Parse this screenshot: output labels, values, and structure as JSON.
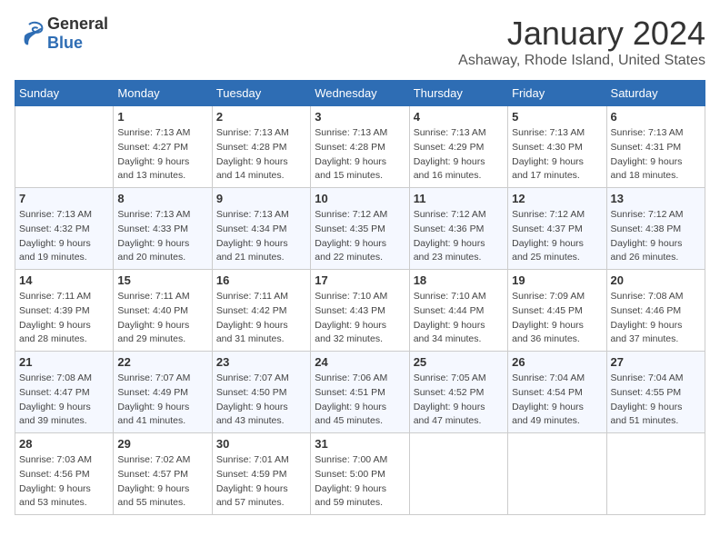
{
  "logo": {
    "general": "General",
    "blue": "Blue"
  },
  "title": "January 2024",
  "subtitle": "Ashaway, Rhode Island, United States",
  "headers": [
    "Sunday",
    "Monday",
    "Tuesday",
    "Wednesday",
    "Thursday",
    "Friday",
    "Saturday"
  ],
  "weeks": [
    [
      {
        "num": "",
        "info": ""
      },
      {
        "num": "1",
        "info": "Sunrise: 7:13 AM\nSunset: 4:27 PM\nDaylight: 9 hours\nand 13 minutes."
      },
      {
        "num": "2",
        "info": "Sunrise: 7:13 AM\nSunset: 4:28 PM\nDaylight: 9 hours\nand 14 minutes."
      },
      {
        "num": "3",
        "info": "Sunrise: 7:13 AM\nSunset: 4:28 PM\nDaylight: 9 hours\nand 15 minutes."
      },
      {
        "num": "4",
        "info": "Sunrise: 7:13 AM\nSunset: 4:29 PM\nDaylight: 9 hours\nand 16 minutes."
      },
      {
        "num": "5",
        "info": "Sunrise: 7:13 AM\nSunset: 4:30 PM\nDaylight: 9 hours\nand 17 minutes."
      },
      {
        "num": "6",
        "info": "Sunrise: 7:13 AM\nSunset: 4:31 PM\nDaylight: 9 hours\nand 18 minutes."
      }
    ],
    [
      {
        "num": "7",
        "info": "Sunrise: 7:13 AM\nSunset: 4:32 PM\nDaylight: 9 hours\nand 19 minutes."
      },
      {
        "num": "8",
        "info": "Sunrise: 7:13 AM\nSunset: 4:33 PM\nDaylight: 9 hours\nand 20 minutes."
      },
      {
        "num": "9",
        "info": "Sunrise: 7:13 AM\nSunset: 4:34 PM\nDaylight: 9 hours\nand 21 minutes."
      },
      {
        "num": "10",
        "info": "Sunrise: 7:12 AM\nSunset: 4:35 PM\nDaylight: 9 hours\nand 22 minutes."
      },
      {
        "num": "11",
        "info": "Sunrise: 7:12 AM\nSunset: 4:36 PM\nDaylight: 9 hours\nand 23 minutes."
      },
      {
        "num": "12",
        "info": "Sunrise: 7:12 AM\nSunset: 4:37 PM\nDaylight: 9 hours\nand 25 minutes."
      },
      {
        "num": "13",
        "info": "Sunrise: 7:12 AM\nSunset: 4:38 PM\nDaylight: 9 hours\nand 26 minutes."
      }
    ],
    [
      {
        "num": "14",
        "info": "Sunrise: 7:11 AM\nSunset: 4:39 PM\nDaylight: 9 hours\nand 28 minutes."
      },
      {
        "num": "15",
        "info": "Sunrise: 7:11 AM\nSunset: 4:40 PM\nDaylight: 9 hours\nand 29 minutes."
      },
      {
        "num": "16",
        "info": "Sunrise: 7:11 AM\nSunset: 4:42 PM\nDaylight: 9 hours\nand 31 minutes."
      },
      {
        "num": "17",
        "info": "Sunrise: 7:10 AM\nSunset: 4:43 PM\nDaylight: 9 hours\nand 32 minutes."
      },
      {
        "num": "18",
        "info": "Sunrise: 7:10 AM\nSunset: 4:44 PM\nDaylight: 9 hours\nand 34 minutes."
      },
      {
        "num": "19",
        "info": "Sunrise: 7:09 AM\nSunset: 4:45 PM\nDaylight: 9 hours\nand 36 minutes."
      },
      {
        "num": "20",
        "info": "Sunrise: 7:08 AM\nSunset: 4:46 PM\nDaylight: 9 hours\nand 37 minutes."
      }
    ],
    [
      {
        "num": "21",
        "info": "Sunrise: 7:08 AM\nSunset: 4:47 PM\nDaylight: 9 hours\nand 39 minutes."
      },
      {
        "num": "22",
        "info": "Sunrise: 7:07 AM\nSunset: 4:49 PM\nDaylight: 9 hours\nand 41 minutes."
      },
      {
        "num": "23",
        "info": "Sunrise: 7:07 AM\nSunset: 4:50 PM\nDaylight: 9 hours\nand 43 minutes."
      },
      {
        "num": "24",
        "info": "Sunrise: 7:06 AM\nSunset: 4:51 PM\nDaylight: 9 hours\nand 45 minutes."
      },
      {
        "num": "25",
        "info": "Sunrise: 7:05 AM\nSunset: 4:52 PM\nDaylight: 9 hours\nand 47 minutes."
      },
      {
        "num": "26",
        "info": "Sunrise: 7:04 AM\nSunset: 4:54 PM\nDaylight: 9 hours\nand 49 minutes."
      },
      {
        "num": "27",
        "info": "Sunrise: 7:04 AM\nSunset: 4:55 PM\nDaylight: 9 hours\nand 51 minutes."
      }
    ],
    [
      {
        "num": "28",
        "info": "Sunrise: 7:03 AM\nSunset: 4:56 PM\nDaylight: 9 hours\nand 53 minutes."
      },
      {
        "num": "29",
        "info": "Sunrise: 7:02 AM\nSunset: 4:57 PM\nDaylight: 9 hours\nand 55 minutes."
      },
      {
        "num": "30",
        "info": "Sunrise: 7:01 AM\nSunset: 4:59 PM\nDaylight: 9 hours\nand 57 minutes."
      },
      {
        "num": "31",
        "info": "Sunrise: 7:00 AM\nSunset: 5:00 PM\nDaylight: 9 hours\nand 59 minutes."
      },
      {
        "num": "",
        "info": ""
      },
      {
        "num": "",
        "info": ""
      },
      {
        "num": "",
        "info": ""
      }
    ]
  ]
}
